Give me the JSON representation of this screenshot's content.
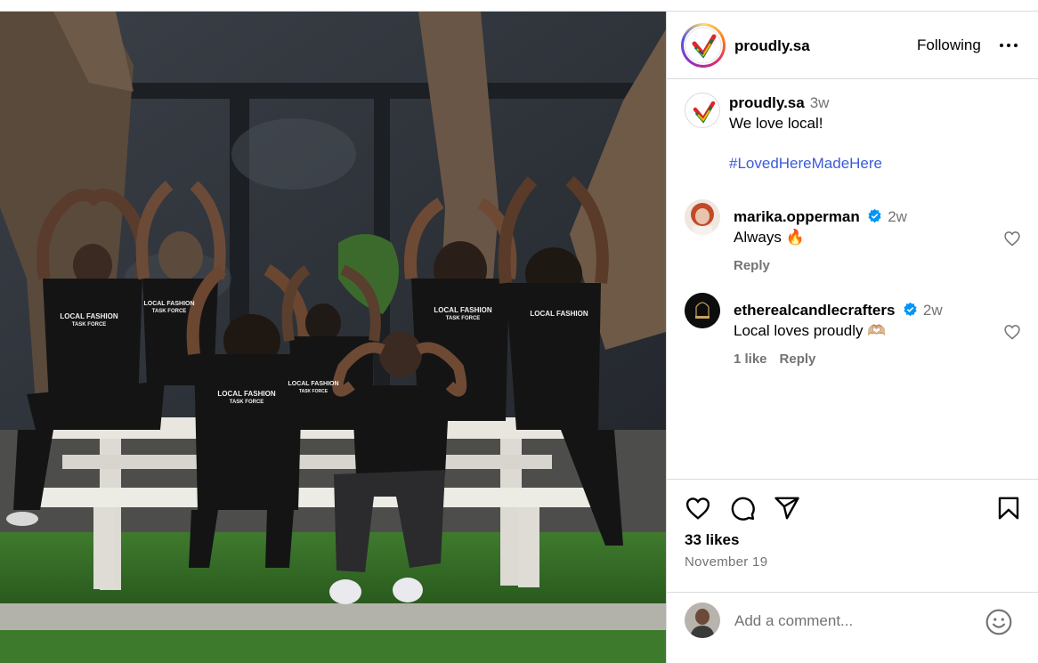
{
  "post": {
    "author": "proudly.sa",
    "follow_label": "Following",
    "caption_time": "3w",
    "caption": "We love local!",
    "hashtag": "#LovedHereMadeHere",
    "likes": "33 likes",
    "date": "November 19",
    "shirt_text_line1": "LOCAL FASHION",
    "shirt_text_line2": "TASK FORCE"
  },
  "comments": [
    {
      "user": "marika.opperman",
      "verified": true,
      "time": "2w",
      "text": "Always 🔥",
      "meta": [
        "Reply"
      ]
    },
    {
      "user": "etherealcandlecrafters",
      "verified": true,
      "time": "2w",
      "text": "Local loves proudly 🫶🏼",
      "meta": [
        "1 like",
        "Reply"
      ]
    }
  ],
  "add_comment": {
    "placeholder": "Add a comment..."
  },
  "icons": {
    "more": "more-options-icon",
    "like": "heart-icon",
    "comment": "comment-bubble-icon",
    "share": "paper-plane-icon",
    "save": "bookmark-icon",
    "emoji": "smiley-icon",
    "verified": "verified-badge-icon"
  },
  "colors": {
    "link": "#3b5bdb",
    "verified": "#0095f6",
    "muted": "#737373",
    "border": "#dbdbdb"
  }
}
